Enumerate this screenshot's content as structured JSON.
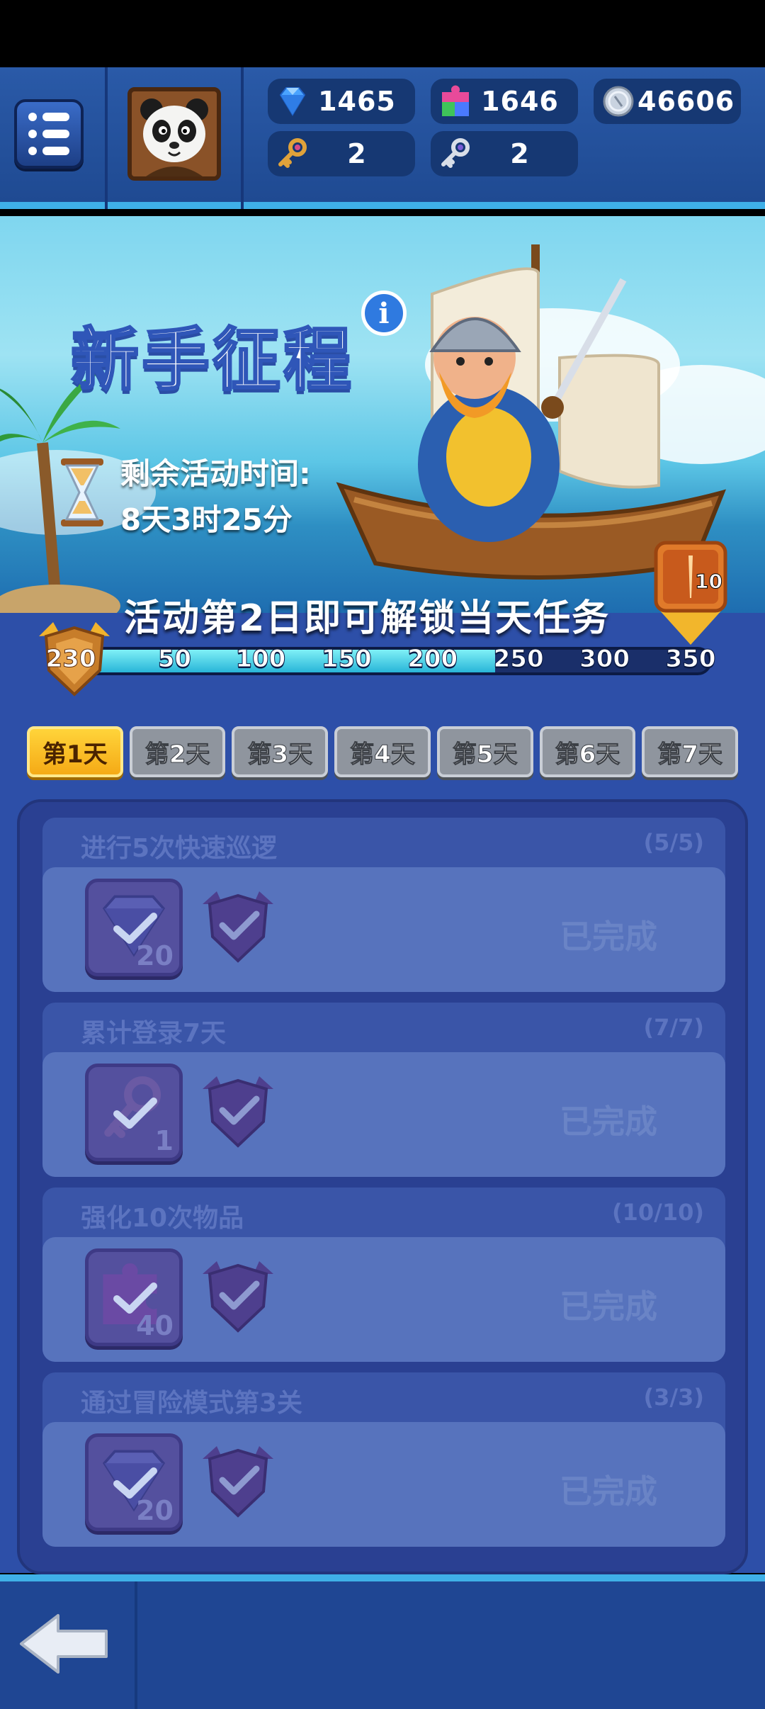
{
  "header": {
    "currencies": [
      {
        "icon": "diamond-icon",
        "value": "1465"
      },
      {
        "icon": "puzzle-icon",
        "value": "1646"
      },
      {
        "icon": "silver-coin-icon",
        "value": "46606"
      },
      {
        "icon": "gold-key-icon",
        "value": "2"
      },
      {
        "icon": "silver-key-icon",
        "value": "2"
      }
    ]
  },
  "banner": {
    "title": "新手征程",
    "info_symbol": "i",
    "timer_label": "剩余活动时间:",
    "timer_value": "8天3时25分"
  },
  "progress": {
    "unlock_message": "活动第2日即可解锁当天任务",
    "current_score": "230",
    "current_value": 230,
    "max_value": 350,
    "ticks": [
      "50",
      "100",
      "150",
      "200",
      "250",
      "300",
      "350"
    ],
    "reward_count": "10"
  },
  "tabs": [
    {
      "label": "第1天",
      "active": true
    },
    {
      "label": "第2天",
      "active": false
    },
    {
      "label": "第3天",
      "active": false
    },
    {
      "label": "第4天",
      "active": false
    },
    {
      "label": "第5天",
      "active": false
    },
    {
      "label": "第6天",
      "active": false
    },
    {
      "label": "第7天",
      "active": false
    }
  ],
  "tasks": [
    {
      "title": "进行5次快速巡逻",
      "count": "(5/5)",
      "reward_icon": "diamond-icon",
      "reward_amount": "20",
      "status": "已完成"
    },
    {
      "title": "累计登录7天",
      "count": "(7/7)",
      "reward_icon": "gold-key-icon",
      "reward_amount": "1",
      "status": "已完成"
    },
    {
      "title": "强化10次物品",
      "count": "(10/10)",
      "reward_icon": "puzzle-icon",
      "reward_amount": "40",
      "status": "已完成"
    },
    {
      "title": "通过冒险模式第3关",
      "count": "(3/3)",
      "reward_icon": "diamond-icon",
      "reward_amount": "20",
      "status": "已完成"
    }
  ],
  "colors": {
    "accent": "#3fb0e8",
    "panel": "#2a4092",
    "active_tab": "#ffd43a",
    "progress_fill": "#28b5d8"
  }
}
